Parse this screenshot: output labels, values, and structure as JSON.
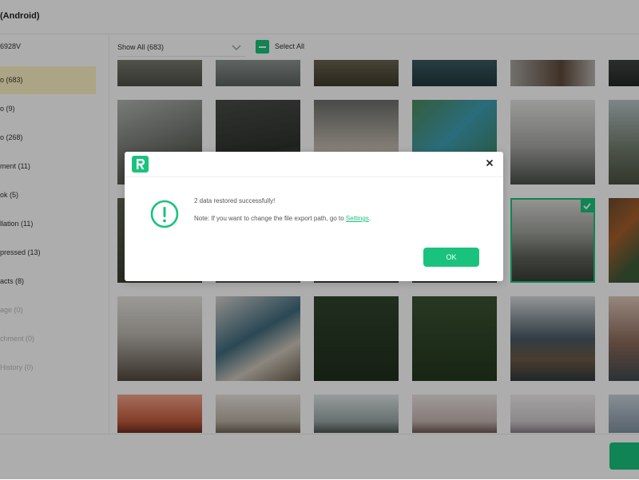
{
  "app": {
    "title": "(Android)"
  },
  "sidebar": {
    "device": "6928V",
    "items": [
      {
        "label": "o (683)",
        "state": "active"
      },
      {
        "label": "o (9)",
        "state": "normal"
      },
      {
        "label": "o (268)",
        "state": "normal"
      },
      {
        "label": "ment (11)",
        "state": "normal"
      },
      {
        "label": "ok (5)",
        "state": "normal"
      },
      {
        "label": "llation (11)",
        "state": "normal"
      },
      {
        "label": "pressed (13)",
        "state": "normal"
      },
      {
        "label": "acts (8)",
        "state": "normal"
      },
      {
        "label": "age (0)",
        "state": "disabled"
      },
      {
        "label": "chment (0)",
        "state": "disabled"
      },
      {
        "label": "History (0)",
        "state": "disabled"
      }
    ]
  },
  "toolbar": {
    "filter_value": "Show All (683)",
    "select_all_label": "Select All"
  },
  "dialog": {
    "message": "2 data restored successfully!",
    "note_text": "Note: If you want to change the file export path, go to ",
    "note_link": "Settings",
    "note_end": ".",
    "ok_label": "OK"
  },
  "icons": {
    "logo": "app-logo-icon",
    "close": "close-icon",
    "alert": "exclamation-circle-icon",
    "dropdown": "chevron-down-icon",
    "check": "checkmark-icon"
  },
  "colors": {
    "accent": "#19c37d",
    "sidebar_active": "#fdf3c4",
    "overlay": "rgba(0,0,0,0.32)"
  }
}
